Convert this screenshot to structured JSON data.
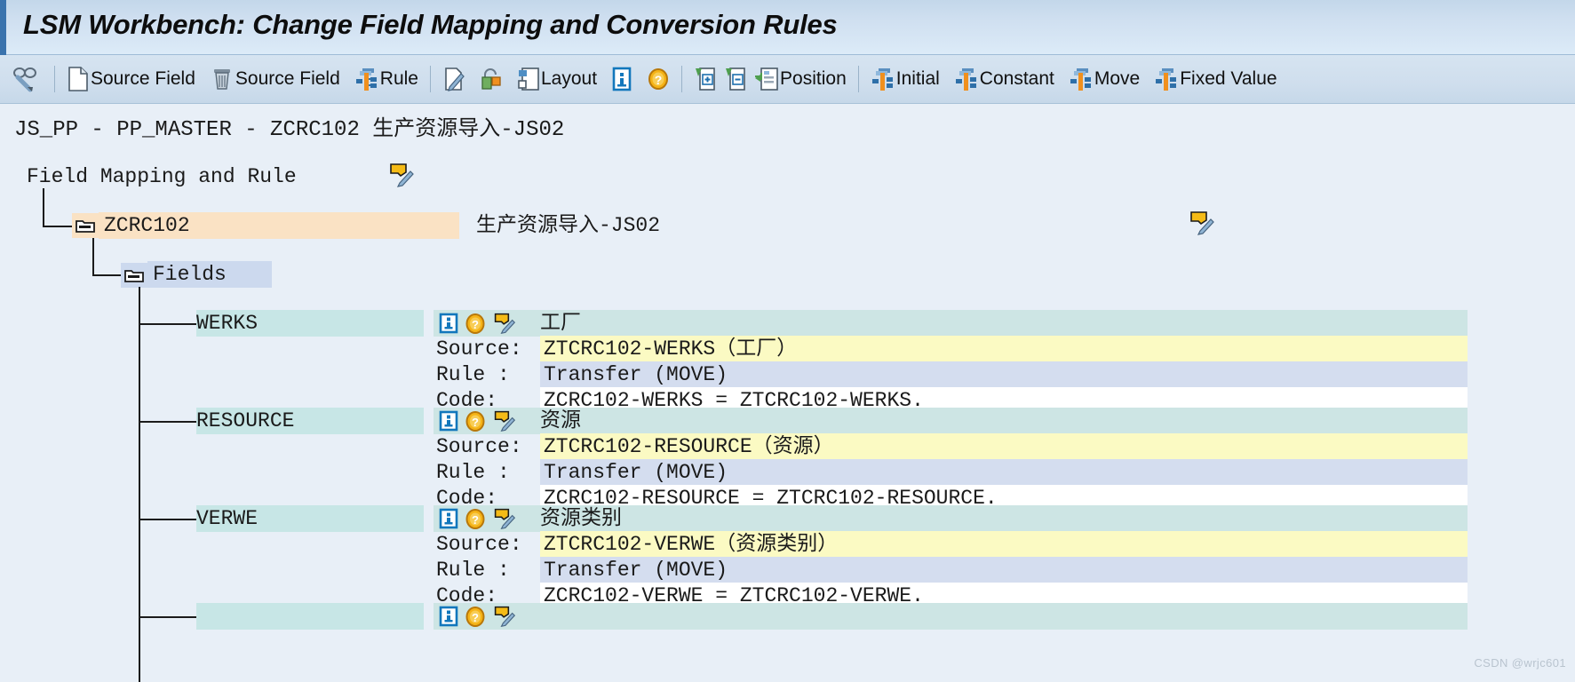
{
  "window": {
    "title": "LSM Workbench: Change Field Mapping and Conversion Rules"
  },
  "toolbar": {
    "items": [
      {
        "icon": "glasses-pencil-icon",
        "label": ""
      },
      {
        "icon": "new-source-field-icon",
        "label": "Source Field"
      },
      {
        "icon": "delete-source-field-icon",
        "label": "Source Field"
      },
      {
        "icon": "rule-icon",
        "label": "Rule"
      },
      {
        "icon": "edit-pencil-icon",
        "label": ""
      },
      {
        "icon": "lock-toggle-icon",
        "label": ""
      },
      {
        "icon": "layout-icon",
        "label": "Layout"
      },
      {
        "icon": "info-icon",
        "label": ""
      },
      {
        "icon": "help-icon",
        "label": ""
      },
      {
        "icon": "expand-node-icon",
        "label": ""
      },
      {
        "icon": "collapse-node-icon",
        "label": ""
      },
      {
        "icon": "position-icon",
        "label": "Position"
      },
      {
        "icon": "initial-rule-icon",
        "label": "Initial"
      },
      {
        "icon": "constant-rule-icon",
        "label": "Constant"
      },
      {
        "icon": "move-rule-icon",
        "label": "Move"
      },
      {
        "icon": "fixed-value-rule-icon",
        "label": "Fixed Value"
      }
    ]
  },
  "path": {
    "text": "JS_PP - PP_MASTER - ZCRC102 生产资源导入-JS02"
  },
  "tree": {
    "root_label": "Field Mapping and Rule",
    "object_node": {
      "name": "ZCRC102",
      "description": "生产资源导入-JS02"
    },
    "fields_node": {
      "label": "Fields"
    },
    "labels": {
      "source": "Source:",
      "rule": "Rule :",
      "code": "Code:"
    },
    "fields": [
      {
        "name": "WERKS",
        "description": "工厂",
        "source": "ZTCRC102-WERKS（工厂）",
        "rule": "Transfer (MOVE)",
        "code": "ZCRC102-WERKS = ZTCRC102-WERKS."
      },
      {
        "name": "RESOURCE",
        "description": "资源",
        "source": "ZTCRC102-RESOURCE（资源）",
        "rule": "Transfer (MOVE)",
        "code": "ZCRC102-RESOURCE = ZTCRC102-RESOURCE."
      },
      {
        "name": "VERWE",
        "description": "资源类别",
        "source": "ZTCRC102-VERWE（资源类别）",
        "rule": "Transfer (MOVE)",
        "code": "ZCRC102-VERWE = ZTCRC102-VERWE."
      }
    ]
  },
  "watermark": {
    "text": "CSDN @wrjc601"
  },
  "colors": {
    "title_accent": "#3a73ad",
    "page_background": "#e8eff7",
    "selected_node": "#fae2c4",
    "fields_node": "#ccd9ee",
    "field_name": "#c7e6e6",
    "description_band": "#cde5e4",
    "source_band": "#fbfac3",
    "rule_band": "#d4ddef",
    "code_band": "#ffffff"
  }
}
